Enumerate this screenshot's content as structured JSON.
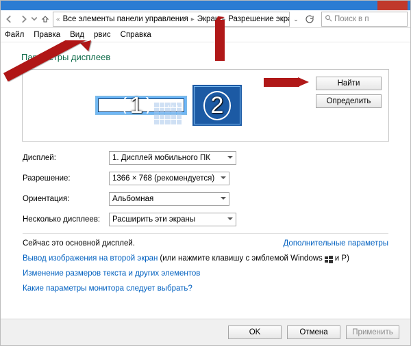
{
  "breadcrumb": {
    "chevrons": "«",
    "all_control_panel": "Все элементы панели управления",
    "screen": "Экран",
    "resolution": "Разрешение экрана"
  },
  "search": {
    "placeholder": "Поиск в п"
  },
  "menubar": {
    "file": "Файл",
    "edit": "Правка",
    "view": "Вид",
    "service": "рвис",
    "help": "Справка"
  },
  "heading": "Параметры дисплеев",
  "monitor_buttons": {
    "find": "Найти",
    "identify": "Определить"
  },
  "monitors": {
    "m1": "1",
    "m2": "2",
    "dots": "..."
  },
  "form": {
    "display_label": "Дисплей:",
    "display_value": "1. Дисплей мобильного ПК",
    "resolution_label": "Разрешение:",
    "resolution_value": "1366 × 768 (рекомендуется)",
    "orientation_label": "Ориентация:",
    "orientation_value": "Альбомная",
    "multi_label": "Несколько дисплеев:",
    "multi_value": "Расширить эти экраны"
  },
  "primary_notice": "Сейчас это основной дисплей.",
  "advanced_link": "Дополнительные параметры",
  "links": {
    "project": "Вывод изображения на второй экран",
    "project_rest_a": "(или нажмите клавишу с эмблемой Windows",
    "project_rest_b": "и P)",
    "textsize": "Изменение размеров текста и других элементов",
    "which": "Какие параметры монитора следует выбрать?"
  },
  "buttons": {
    "ok": "OK",
    "cancel": "Отмена",
    "apply": "Применить"
  }
}
